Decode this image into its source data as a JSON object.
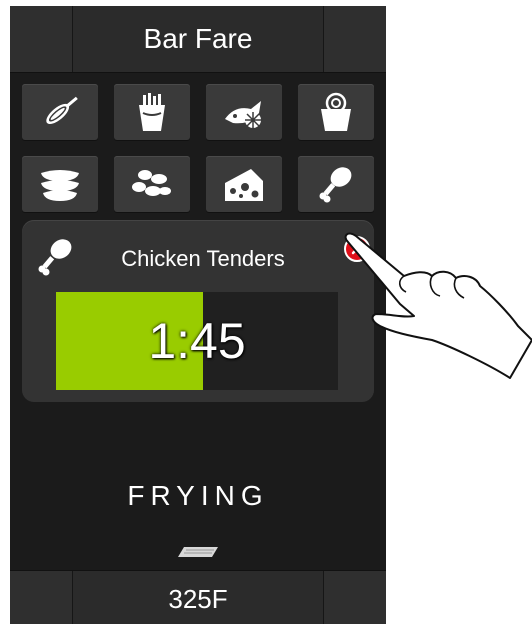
{
  "header": {
    "title": "Bar Fare"
  },
  "icons": [
    {
      "name": "corn-dog-icon",
      "label": "Corn dog"
    },
    {
      "name": "fries-icon",
      "label": "Fries"
    },
    {
      "name": "fish-icon",
      "label": "Fish"
    },
    {
      "name": "onion-rings-icon",
      "label": "Onion rings"
    },
    {
      "name": "plates-icon",
      "label": "Stacked plates"
    },
    {
      "name": "nuggets-icon",
      "label": "Nuggets"
    },
    {
      "name": "cheese-icon",
      "label": "Cheese"
    },
    {
      "name": "chicken-leg-icon",
      "label": "Chicken leg"
    }
  ],
  "timer": {
    "item_icon": "chicken-leg-icon",
    "item_name": "Chicken Tenders",
    "time": "1:45",
    "progress": 0.52,
    "close_icon": "close-icon",
    "fill_color": "#99cc00",
    "close_color": "#e0101a"
  },
  "status": {
    "text": "FRYING"
  },
  "footer": {
    "temperature": "325F"
  }
}
